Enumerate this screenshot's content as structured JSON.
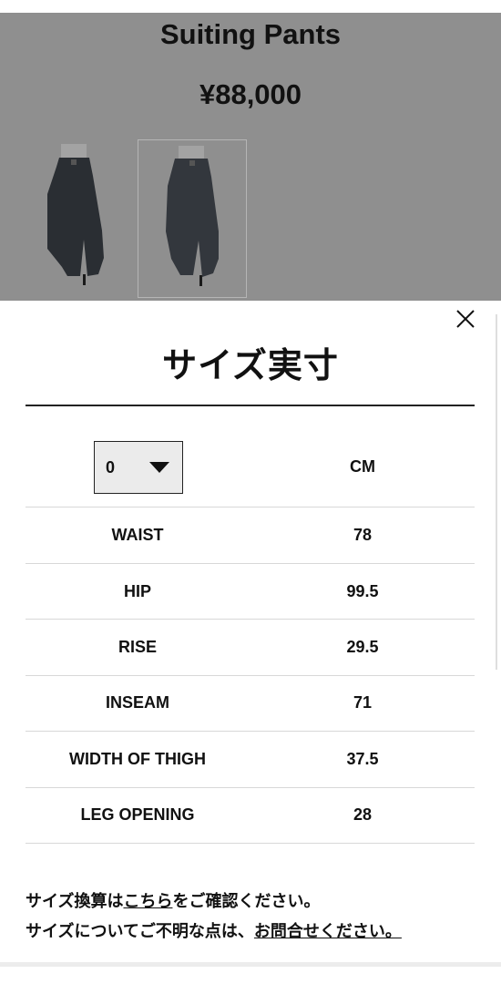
{
  "product": {
    "title": "Suiting Pants",
    "price": "¥88,000",
    "thumbnails": [
      {
        "name": "front-view",
        "selected": false
      },
      {
        "name": "side-view",
        "selected": true
      }
    ]
  },
  "modal": {
    "title": "サイズ実寸",
    "close_icon": "close-icon",
    "size_select_value": "0",
    "unit": "CM",
    "rows": [
      {
        "label": "WAIST",
        "value": "78"
      },
      {
        "label": "HIP",
        "value": "99.5"
      },
      {
        "label": "RISE",
        "value": "29.5"
      },
      {
        "label": "INSEAM",
        "value": "71"
      },
      {
        "label": "WIDTH OF THIGH",
        "value": "37.5"
      },
      {
        "label": "LEG OPENING",
        "value": "28"
      }
    ],
    "note1_prefix": "サイズ換算は",
    "note1_link": "こちら",
    "note1_suffix": "をご確認ください。",
    "note2_prefix": "サイズについてご不明な点は、",
    "note2_link": "お問合せください。"
  },
  "colors": {
    "overlay": "#8f8f8f",
    "pants": "#2a2e33"
  }
}
